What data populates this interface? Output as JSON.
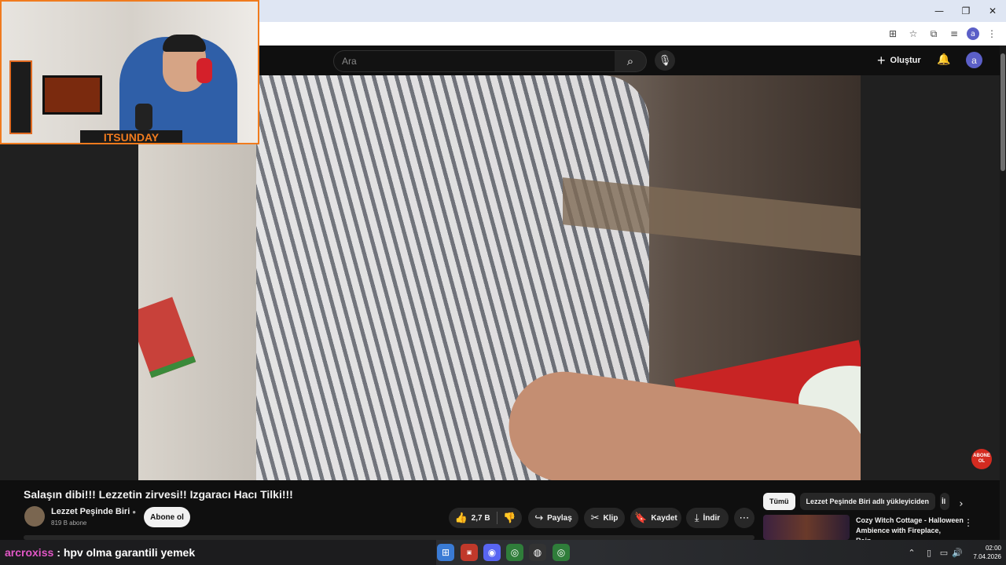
{
  "browser": {
    "window_controls": {
      "minimize": "—",
      "restore": "❐",
      "close": "✕"
    },
    "toolbar_icons": [
      "install-icon",
      "star-icon",
      "extensions-icon",
      "media-icon",
      "profile-icon",
      "menu-icon"
    ],
    "profile_initial": "a"
  },
  "header": {
    "search_placeholder": "Ara",
    "create_label": "Oluştur",
    "account_initial": "a"
  },
  "webcam": {
    "name": "ITSUNDAY"
  },
  "video": {
    "title": "Salaşın dibi!!! Lezzetin zirvesi!! Izgaracı Hacı Tilki!!!",
    "subscribe_badge": "ABONE OL"
  },
  "channel": {
    "name": "Lezzet Peşinde Biri",
    "subscribers": "819 B abone",
    "subscribe_label": "Abone ol"
  },
  "actions": {
    "likes": "2,7 B",
    "share": "Paylaş",
    "clip": "Klip",
    "save": "Kaydet",
    "download": "İndir",
    "more": "⋯"
  },
  "sidebar": {
    "chips": [
      "Tümü",
      "Lezzet Peşinde Biri adlı yükleyiciden",
      "İl"
    ],
    "recommendation": {
      "title": "Cozy Witch Cottage - Halloween Ambience with Fireplace, Rain,..."
    }
  },
  "chat": {
    "user": "arcroxiss",
    "message": ": hpv olma garantili yemek"
  },
  "taskbar": {
    "time": "02:00",
    "date": "7.04.2026"
  },
  "colors": {
    "background": "#0f0f0f",
    "chat_user": "#e357c7",
    "webcam_accent": "#f07b1e",
    "subscribe_badge": "#d42b20"
  }
}
